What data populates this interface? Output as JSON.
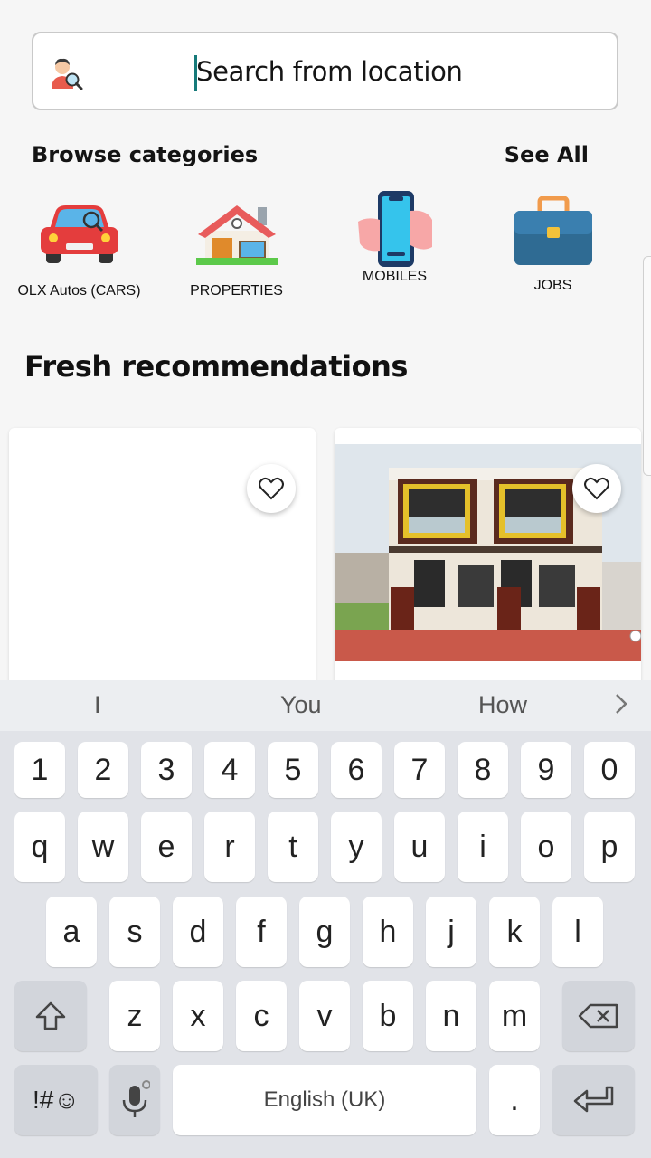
{
  "search": {
    "placeholder": "Search from location"
  },
  "browse": {
    "title": "Browse categories",
    "see_all": "See All",
    "categories": [
      {
        "label": "OLX Autos (CARS)",
        "icon": "car-icon"
      },
      {
        "label": "PROPERTIES",
        "icon": "house-icon"
      },
      {
        "label": "MOBILES",
        "icon": "mobile-phone-icon"
      },
      {
        "label": "JOBS",
        "icon": "briefcase-icon"
      }
    ]
  },
  "fresh": {
    "title": "Fresh recommendations"
  },
  "keyboard": {
    "suggestions": [
      "I",
      "You",
      "How"
    ],
    "number_row": [
      "1",
      "2",
      "3",
      "4",
      "5",
      "6",
      "7",
      "8",
      "9",
      "0"
    ],
    "row1": [
      "q",
      "w",
      "e",
      "r",
      "t",
      "y",
      "u",
      "i",
      "o",
      "p"
    ],
    "row2": [
      "a",
      "s",
      "d",
      "f",
      "g",
      "h",
      "j",
      "k",
      "l"
    ],
    "row3": [
      "z",
      "x",
      "c",
      "v",
      "b",
      "n",
      "m"
    ],
    "symbols_label": "!#☺",
    "space_label": "English (UK)",
    "period_label": "."
  }
}
